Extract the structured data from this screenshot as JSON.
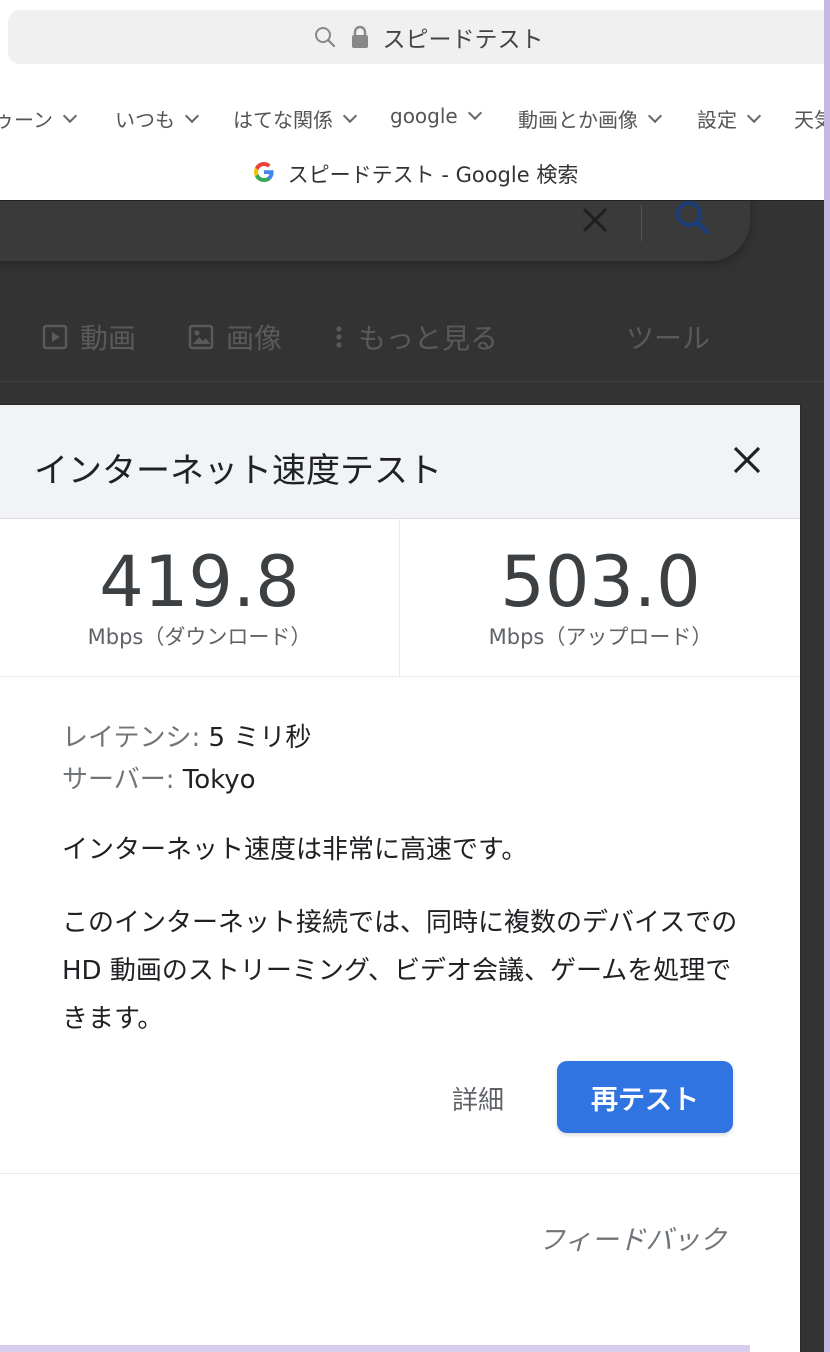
{
  "browser": {
    "address": "スピードテスト",
    "bookmarks": [
      {
        "label": "ゥーン"
      },
      {
        "label": "いつも"
      },
      {
        "label": "はてな関係"
      },
      {
        "label": "google"
      },
      {
        "label": "動画とか画像"
      },
      {
        "label": "設定"
      },
      {
        "label": "天気"
      }
    ],
    "tab_title": "スピードテスト - Google 検索"
  },
  "google": {
    "tabs": [
      {
        "label": "動画",
        "icon": "video-icon"
      },
      {
        "label": "画像",
        "icon": "image-icon"
      },
      {
        "label": "もっと見る",
        "icon": "more-vert-icon"
      },
      {
        "label": "ツール"
      }
    ]
  },
  "dialog": {
    "title": "インターネット速度テスト",
    "download": {
      "value": "419.8",
      "label": "Mbps（ダウンロード）"
    },
    "upload": {
      "value": "503.0",
      "label": "Mbps（アップロード）"
    },
    "latency_key": "レイテンシ:",
    "latency_value": "5 ミリ秒",
    "server_key": "サーバー:",
    "server_value": "Tokyo",
    "message_1": "インターネット速度は非常に高速です。",
    "message_2": "このインターネット接続では、同時に複数のデバイスでの HD 動画のストリーミング、ビデオ会議、ゲームを処理できます。",
    "detail_label": "詳細",
    "retest_label": "再テスト",
    "feedback_label": "フィードバック"
  },
  "colors": {
    "accent": "#2f74e0",
    "overlay": "#333333",
    "dialog_header": "#f1f3f4"
  }
}
